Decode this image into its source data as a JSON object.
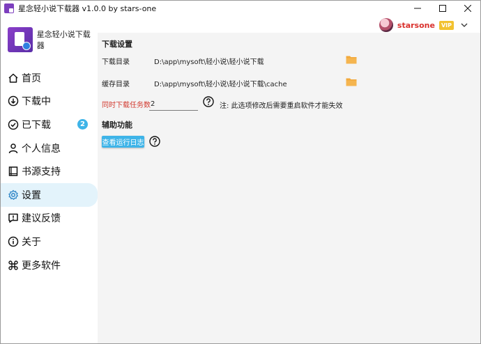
{
  "window": {
    "title": "星念轻小说下载器 v1.0.0 by stars-one"
  },
  "header": {
    "username": "starsone",
    "vip_label": "VIP"
  },
  "sidebar": {
    "app_name": "星念轻小说下载器",
    "items": [
      {
        "label": "首页",
        "icon": "home-icon"
      },
      {
        "label": "下载中",
        "icon": "download-icon"
      },
      {
        "label": "已下载",
        "icon": "check-circle-icon",
        "badge": "2"
      },
      {
        "label": "个人信息",
        "icon": "user-icon"
      },
      {
        "label": "书源支持",
        "icon": "book-icon"
      },
      {
        "label": "设置",
        "icon": "gear-icon",
        "active": true
      },
      {
        "label": "建议反馈",
        "icon": "feedback-icon"
      },
      {
        "label": "关于",
        "icon": "info-icon"
      },
      {
        "label": "更多软件",
        "icon": "command-icon"
      }
    ]
  },
  "settings": {
    "download_section_title": "下载设置",
    "download_dir_label": "下载目录",
    "download_dir_value": "D:\\app\\mysoft\\轻小说\\轻小说下载",
    "cache_dir_label": "缓存目录",
    "cache_dir_value": "D:\\app\\mysoft\\轻小说\\轻小说下载\\cache",
    "concurrent_label": "同时下载任务数",
    "concurrent_value": "2",
    "concurrent_note": "注: 此选项修改后需要重启软件才能失效",
    "aux_section_title": "辅助功能",
    "view_log_label": "查看运行日志"
  },
  "colors": {
    "accent": "#3eb4e8",
    "active_nav_bg": "#e3f3fb",
    "warn": "#d23a2f",
    "folder": "#f2a93b",
    "username": "#d9302c",
    "vip": "#f2c230"
  }
}
